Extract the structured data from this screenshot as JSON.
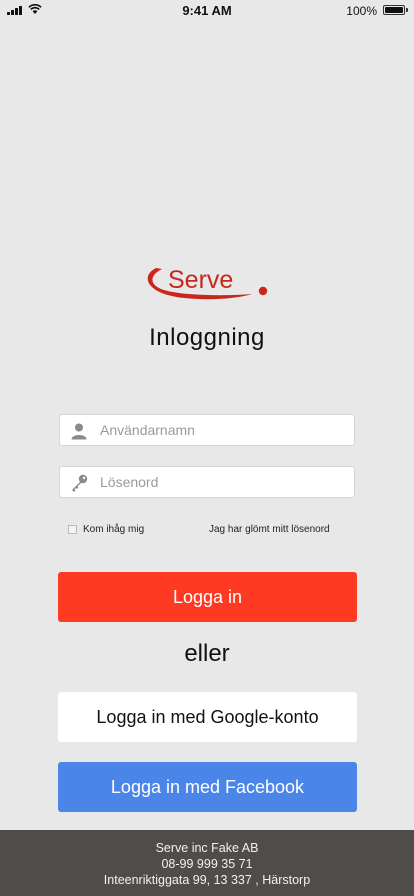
{
  "status_bar": {
    "time": "9:41 AM",
    "battery": "100%"
  },
  "brand": {
    "logo_text": "Serve",
    "color": "#c8281c"
  },
  "title": "Inloggning",
  "form": {
    "username_placeholder": "Användarnamn",
    "password_placeholder": "Lösenord",
    "remember_label": "Kom ihåg mig",
    "forgot_label": "Jag har glömt mitt lösenord"
  },
  "buttons": {
    "login": "Logga in",
    "or": "eller",
    "google": "Logga in med Google-konto",
    "facebook": "Logga in med Facebook"
  },
  "footer": {
    "company": "Serve inc Fake AB",
    "phone": "08-99 999 35 71",
    "address": "Inteenriktiggata 99, 13 337 , Härstorp"
  },
  "colors": {
    "login": "#ff3a22",
    "facebook": "#4a86e8",
    "footer": "#4f4c4a",
    "background": "#e8e8e8"
  }
}
